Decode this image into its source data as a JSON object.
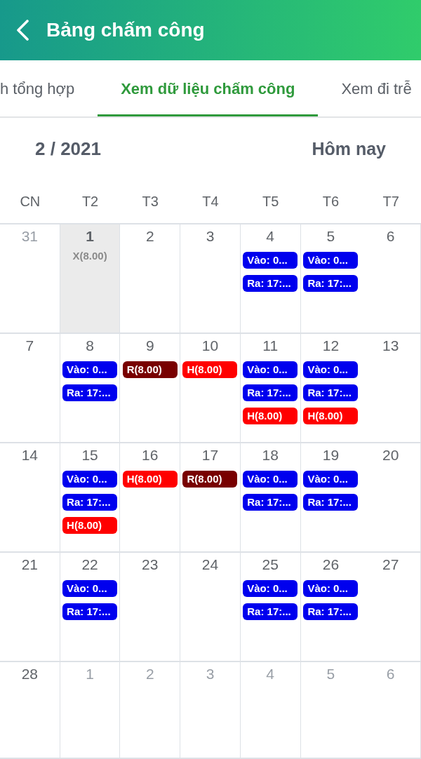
{
  "header": {
    "title": "Bảng chấm công"
  },
  "tabs": [
    {
      "label": "h tổng hợp",
      "selected": false
    },
    {
      "label": "Xem dữ liệu chấm công",
      "selected": true
    },
    {
      "label": "Xem đi trễ",
      "selected": false
    }
  ],
  "calendar": {
    "month": "2 / 2021",
    "today_button": "Hôm nay",
    "weekdays": [
      "CN",
      "T2",
      "T3",
      "T4",
      "T5",
      "T6",
      "T7"
    ],
    "weeks": [
      {
        "days": [
          {
            "day": "31",
            "in_month": false,
            "selected": false
          },
          {
            "day": "1",
            "in_month": true,
            "selected": true,
            "events": [
              {
                "kind": "text",
                "label": "X(8.00)",
                "color": "#8a8a8a"
              }
            ]
          },
          {
            "day": "2",
            "in_month": true,
            "selected": false
          },
          {
            "day": "3",
            "in_month": true,
            "selected": false
          },
          {
            "day": "4",
            "in_month": true,
            "selected": false,
            "events": [
              {
                "kind": "chip",
                "label": "Vào: 0...",
                "color": "#0000ee"
              },
              {
                "kind": "chip",
                "label": "Ra: 17:...",
                "color": "#0000ee"
              }
            ]
          },
          {
            "day": "5",
            "in_month": true,
            "selected": false,
            "events": [
              {
                "kind": "chip",
                "label": "Vào: 0...",
                "color": "#0000ee"
              },
              {
                "kind": "chip",
                "label": "Ra: 17:...",
                "color": "#0000ee"
              }
            ]
          },
          {
            "day": "6",
            "in_month": true,
            "selected": false
          }
        ]
      },
      {
        "days": [
          {
            "day": "7",
            "in_month": true,
            "selected": false
          },
          {
            "day": "8",
            "in_month": true,
            "selected": false,
            "events": [
              {
                "kind": "chip",
                "label": "Vào: 0...",
                "color": "#0000ee"
              },
              {
                "kind": "chip",
                "label": "Ra: 17:...",
                "color": "#0000ee"
              }
            ]
          },
          {
            "day": "9",
            "in_month": true,
            "selected": false,
            "events": [
              {
                "kind": "chip",
                "label": "R(8.00)",
                "color": "#780000"
              }
            ]
          },
          {
            "day": "10",
            "in_month": true,
            "selected": false,
            "events": [
              {
                "kind": "chip",
                "label": "H(8.00)",
                "color": "#ff0000"
              }
            ]
          },
          {
            "day": "11",
            "in_month": true,
            "selected": false,
            "events": [
              {
                "kind": "chip",
                "label": "Vào: 0...",
                "color": "#0000ee"
              },
              {
                "kind": "chip",
                "label": "Ra: 17:...",
                "color": "#0000ee"
              },
              {
                "kind": "chip",
                "label": "H(8.00)",
                "color": "#ff0000"
              }
            ]
          },
          {
            "day": "12",
            "in_month": true,
            "selected": false,
            "events": [
              {
                "kind": "chip",
                "label": "Vào: 0...",
                "color": "#0000ee"
              },
              {
                "kind": "chip",
                "label": "Ra: 17:...",
                "color": "#0000ee"
              },
              {
                "kind": "chip",
                "label": "H(8.00)",
                "color": "#ff0000"
              }
            ]
          },
          {
            "day": "13",
            "in_month": true,
            "selected": false
          }
        ]
      },
      {
        "days": [
          {
            "day": "14",
            "in_month": true,
            "selected": false
          },
          {
            "day": "15",
            "in_month": true,
            "selected": false,
            "events": [
              {
                "kind": "chip",
                "label": "Vào: 0...",
                "color": "#0000ee"
              },
              {
                "kind": "chip",
                "label": "Ra: 17:...",
                "color": "#0000ee"
              },
              {
                "kind": "chip",
                "label": "H(8.00)",
                "color": "#ff0000"
              }
            ]
          },
          {
            "day": "16",
            "in_month": true,
            "selected": false,
            "events": [
              {
                "kind": "chip",
                "label": "H(8.00)",
                "color": "#ff0000"
              }
            ]
          },
          {
            "day": "17",
            "in_month": true,
            "selected": false,
            "events": [
              {
                "kind": "chip",
                "label": "R(8.00)",
                "color": "#780000"
              }
            ]
          },
          {
            "day": "18",
            "in_month": true,
            "selected": false,
            "events": [
              {
                "kind": "chip",
                "label": "Vào: 0...",
                "color": "#0000ee"
              },
              {
                "kind": "chip",
                "label": "Ra: 17:...",
                "color": "#0000ee"
              }
            ]
          },
          {
            "day": "19",
            "in_month": true,
            "selected": false,
            "events": [
              {
                "kind": "chip",
                "label": "Vào: 0...",
                "color": "#0000ee"
              },
              {
                "kind": "chip",
                "label": "Ra: 17:...",
                "color": "#0000ee"
              }
            ]
          },
          {
            "day": "20",
            "in_month": true,
            "selected": false
          }
        ]
      },
      {
        "days": [
          {
            "day": "21",
            "in_month": true,
            "selected": false
          },
          {
            "day": "22",
            "in_month": true,
            "selected": false,
            "events": [
              {
                "kind": "chip",
                "label": "Vào: 0...",
                "color": "#0000ee"
              },
              {
                "kind": "chip",
                "label": "Ra: 17:...",
                "color": "#0000ee"
              }
            ]
          },
          {
            "day": "23",
            "in_month": true,
            "selected": false
          },
          {
            "day": "24",
            "in_month": true,
            "selected": false
          },
          {
            "day": "25",
            "in_month": true,
            "selected": false,
            "events": [
              {
                "kind": "chip",
                "label": "Vào: 0...",
                "color": "#0000ee"
              },
              {
                "kind": "chip",
                "label": "Ra: 17:...",
                "color": "#0000ee"
              }
            ]
          },
          {
            "day": "26",
            "in_month": true,
            "selected": false,
            "events": [
              {
                "kind": "chip",
                "label": "Vào: 0...",
                "color": "#0000ee"
              },
              {
                "kind": "chip",
                "label": "Ra: 17:...",
                "color": "#0000ee"
              }
            ]
          },
          {
            "day": "27",
            "in_month": true,
            "selected": false
          }
        ]
      },
      {
        "days": [
          {
            "day": "28",
            "in_month": true,
            "selected": false
          },
          {
            "day": "1",
            "in_month": false,
            "selected": false
          },
          {
            "day": "2",
            "in_month": false,
            "selected": false
          },
          {
            "day": "3",
            "in_month": false,
            "selected": false
          },
          {
            "day": "4",
            "in_month": false,
            "selected": false
          },
          {
            "day": "5",
            "in_month": false,
            "selected": false
          },
          {
            "day": "6",
            "in_month": false,
            "selected": false
          }
        ]
      }
    ]
  }
}
